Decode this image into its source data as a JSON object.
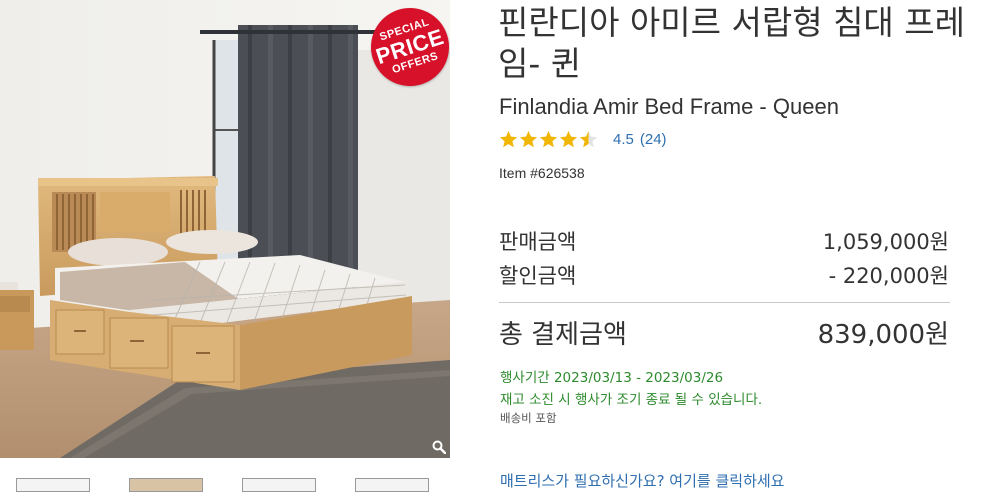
{
  "product": {
    "title_ko": "핀란디아 아미르 서랍형 침대 프레임- 퀸",
    "title_en": "Finlandia Amir Bed Frame - Queen",
    "rating_value": "4.5",
    "rating_count": "(24)",
    "rating_stars": 4.5,
    "item_number": "Item #626538"
  },
  "badge": {
    "line1": "SPECIAL",
    "line2": "PRICE",
    "line3": "OFFERS",
    "color": "#d8112a"
  },
  "pricing": {
    "sale_label": "판매금액",
    "sale_amount": "1,059,000원",
    "discount_label": "할인금액",
    "discount_amount": "- 220,000원",
    "total_label": "총 결제금액",
    "total_amount": "839,000원"
  },
  "promo": {
    "period": "행사기간 2023/03/13 - 2023/03/26",
    "stock_note": "재고 소진 시 행사가 조기 종료 될 수 있습니다.",
    "shipping": "배송비 포함"
  },
  "mattress_link": "매트리스가 필요하신가요? 여기를 클릭하세요",
  "icons": {
    "zoom": "magnifier-icon",
    "star": "star-icon"
  },
  "colors": {
    "link": "#2f6fb0",
    "promo_green": "#2e8b2e",
    "star": "#f2b705"
  }
}
